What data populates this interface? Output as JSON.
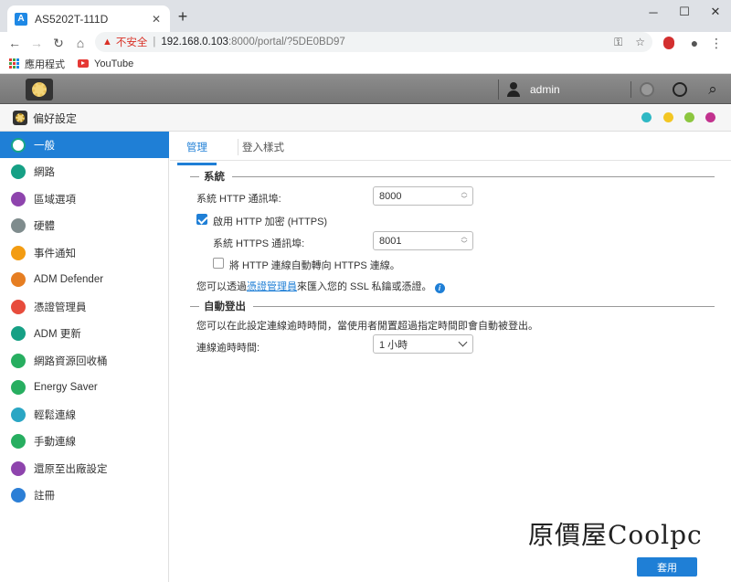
{
  "browser": {
    "tab_title": "AS5202T-111D",
    "tab_favicon_letter": "A",
    "new_tab": "+",
    "address": {
      "warning": "不安全",
      "host": "192.168.0.103",
      "rest": ":8000/portal/?5DE0BD97"
    },
    "bookmarks": [
      {
        "label": "應用程式",
        "icon": "apps-grid-icon"
      },
      {
        "label": "YouTube",
        "icon": "youtube-icon"
      }
    ]
  },
  "adm": {
    "user": "admin"
  },
  "window": {
    "title": "偏好設定",
    "dots": [
      "#2fb8c4",
      "#f3c623",
      "#8cc63f",
      "#c2328e"
    ]
  },
  "sidebar": {
    "items": [
      {
        "label": "一般",
        "icon": "general-icon",
        "color": "#17a589",
        "active": true
      },
      {
        "label": "網路",
        "icon": "globe-icon",
        "color": "#16a085"
      },
      {
        "label": "區域選項",
        "icon": "region-icon",
        "color": "#8e44ad"
      },
      {
        "label": "硬體",
        "icon": "hardware-icon",
        "color": "#7f8c8d"
      },
      {
        "label": "事件通知",
        "icon": "alert-icon",
        "color": "#f39c12"
      },
      {
        "label": "ADM Defender",
        "icon": "defender-icon",
        "color": "#e67e22"
      },
      {
        "label": "憑證管理員",
        "icon": "certificate-icon",
        "color": "#e74c3c"
      },
      {
        "label": "ADM 更新",
        "icon": "update-icon",
        "color": "#16a085"
      },
      {
        "label": "網路資源回收桶",
        "icon": "recycle-bin-icon",
        "color": "#27ae60"
      },
      {
        "label": "Energy Saver",
        "icon": "energy-icon",
        "color": "#27ae60"
      },
      {
        "label": "輕鬆連線",
        "icon": "cloud-connect-icon",
        "color": "#2aa6c4"
      },
      {
        "label": "手動連線",
        "icon": "manual-connect-icon",
        "color": "#27ae60"
      },
      {
        "label": "還原至出廠設定",
        "icon": "restore-icon",
        "color": "#8e44ad"
      },
      {
        "label": "註冊",
        "icon": "register-icon",
        "color": "#2c7fd6"
      }
    ]
  },
  "main": {
    "tabs": [
      "管理",
      "登入樣式"
    ],
    "system": {
      "heading": "系統",
      "http_port_label": "系統 HTTP 通訊埠:",
      "http_port_value": "8000",
      "https_enable_label": "啟用 HTTP 加密 (HTTPS)",
      "https_port_label": "系統 HTTPS 通訊埠:",
      "https_port_value": "8001",
      "redirect_label": "將 HTTP 連線自動轉向 HTTPS 連線。",
      "ssl_note_prefix": "您可以透過",
      "ssl_note_link": "憑證管理員",
      "ssl_note_suffix": "來匯入您的 SSL 私鑰或憑證。"
    },
    "logout": {
      "heading": "自動登出",
      "note": "您可以在此設定連線逾時時間，當使用者閒置超過指定時間即會自動被登出。",
      "timeout_label": "連線逾時時間:",
      "timeout_value": "1 小時"
    },
    "watermark": "原價屋Coolpc",
    "apply_label": "套用"
  }
}
